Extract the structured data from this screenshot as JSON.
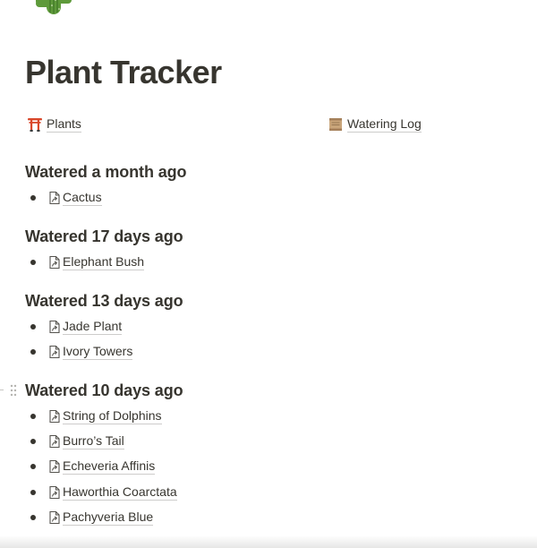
{
  "page": {
    "icon": "cactus-icon",
    "title": "Plant Tracker"
  },
  "links": [
    {
      "icon": "torii-gate-icon",
      "label": "Plants"
    },
    {
      "icon": "scroll-icon",
      "label": "Watering Log"
    }
  ],
  "sections": [
    {
      "heading": "Watered a month ago",
      "items": [
        "Cactus"
      ]
    },
    {
      "heading": "Watered 17 days ago",
      "items": [
        "Elephant Bush"
      ]
    },
    {
      "heading": "Watered 13 days ago",
      "items": [
        "Jade Plant",
        "Ivory Towers"
      ]
    },
    {
      "heading": "Watered 10 days ago",
      "items": [
        "String of Dolphins",
        "Burro’s Tail",
        "Echeveria Affinis",
        "Haworthia Coarctata",
        "Pachyveria Blue"
      ]
    }
  ],
  "colors": {
    "text": "#37352f",
    "background": "#ffffff",
    "underline": "#c9c8c4"
  }
}
